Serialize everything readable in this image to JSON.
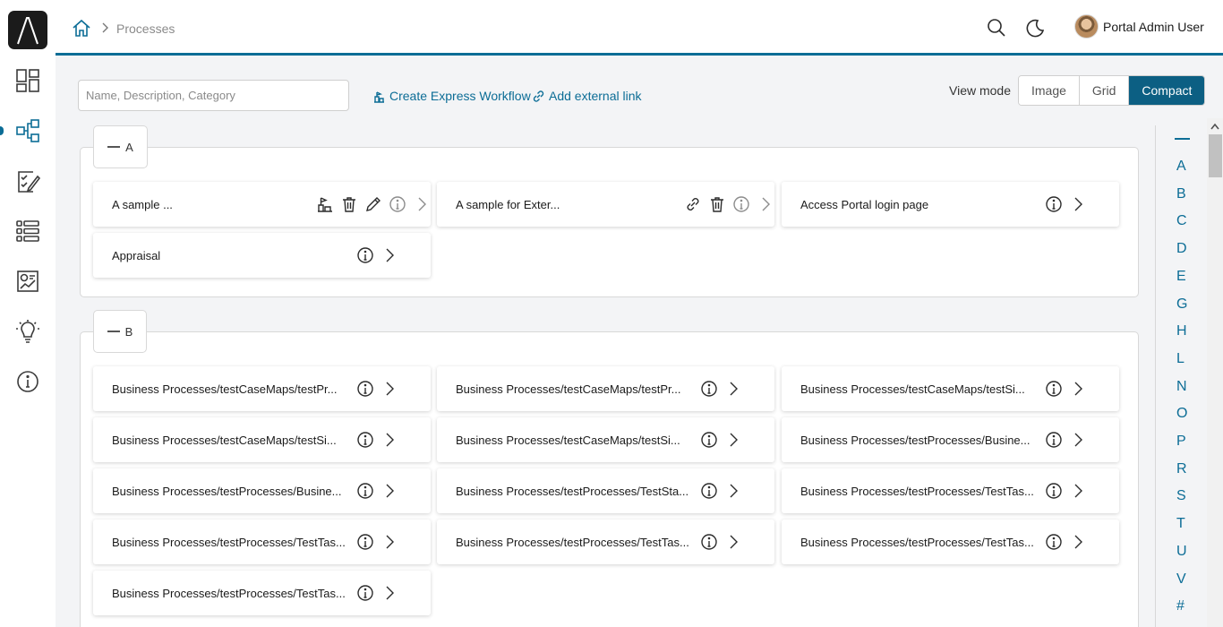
{
  "app": {
    "brand_color": "#0c6d96"
  },
  "breadcrumb": {
    "current": "Processes"
  },
  "user": {
    "name": "Portal Admin User"
  },
  "nav": {
    "items": [
      {
        "name": "dashboard-icon",
        "active": false
      },
      {
        "name": "processes-icon",
        "active": true
      },
      {
        "name": "tasks-icon",
        "active": false
      },
      {
        "name": "cases-icon",
        "active": false
      },
      {
        "name": "statistics-icon",
        "active": false
      },
      {
        "name": "ideas-icon",
        "active": false
      },
      {
        "name": "info-icon",
        "active": false
      }
    ]
  },
  "toolbar": {
    "search_placeholder": "Name, Description, Category",
    "create_workflow": "Create Express Workflow",
    "add_link": "Add external link",
    "view_mode_label": "View mode",
    "view_modes": [
      "Image",
      "Grid",
      "Compact"
    ],
    "active_view_mode": "Compact"
  },
  "groups": [
    {
      "letter": "A",
      "cards": [
        {
          "label": "A sample ...",
          "icons": [
            "workflow-icon",
            "delete-icon",
            "edit-icon",
            "info-icon",
            "chevron-right-icon"
          ],
          "muted_tail": true
        },
        {
          "label": "A sample for Exter...",
          "icons": [
            "link-icon",
            "delete-icon",
            "info-icon",
            "chevron-right-icon"
          ],
          "muted_tail": true
        },
        {
          "label": "Access Portal login page",
          "icons": [
            "info-icon",
            "chevron-right-icon"
          ]
        },
        {
          "label": "Appraisal",
          "icons": [
            "info-icon",
            "chevron-right-icon"
          ]
        }
      ]
    },
    {
      "letter": "B",
      "cards": [
        {
          "label": "Business Processes/testCaseMaps/testPr...",
          "icons": [
            "info-icon",
            "chevron-right-icon"
          ]
        },
        {
          "label": "Business Processes/testCaseMaps/testPr...",
          "icons": [
            "info-icon",
            "chevron-right-icon"
          ]
        },
        {
          "label": "Business Processes/testCaseMaps/testSi...",
          "icons": [
            "info-icon",
            "chevron-right-icon"
          ]
        },
        {
          "label": "Business Processes/testCaseMaps/testSi...",
          "icons": [
            "info-icon",
            "chevron-right-icon"
          ]
        },
        {
          "label": "Business Processes/testCaseMaps/testSi...",
          "icons": [
            "info-icon",
            "chevron-right-icon"
          ]
        },
        {
          "label": "Business Processes/testProcesses/Busine...",
          "icons": [
            "info-icon",
            "chevron-right-icon"
          ]
        },
        {
          "label": "Business Processes/testProcesses/Busine...",
          "icons": [
            "info-icon",
            "chevron-right-icon"
          ]
        },
        {
          "label": "Business Processes/testProcesses/TestSta...",
          "icons": [
            "info-icon",
            "chevron-right-icon"
          ]
        },
        {
          "label": "Business Processes/testProcesses/TestTas...",
          "icons": [
            "info-icon",
            "chevron-right-icon"
          ]
        },
        {
          "label": "Business Processes/testProcesses/TestTas...",
          "icons": [
            "info-icon",
            "chevron-right-icon"
          ]
        },
        {
          "label": "Business Processes/testProcesses/TestTas...",
          "icons": [
            "info-icon",
            "chevron-right-icon"
          ]
        },
        {
          "label": "Business Processes/testProcesses/TestTas...",
          "icons": [
            "info-icon",
            "chevron-right-icon"
          ]
        },
        {
          "label": "Business Processes/testProcesses/TestTas...",
          "icons": [
            "info-icon",
            "chevron-right-icon"
          ]
        }
      ]
    }
  ],
  "alphabet_index": [
    "A",
    "B",
    "C",
    "D",
    "E",
    "G",
    "H",
    "L",
    "N",
    "O",
    "P",
    "R",
    "S",
    "T",
    "U",
    "V",
    "#"
  ]
}
